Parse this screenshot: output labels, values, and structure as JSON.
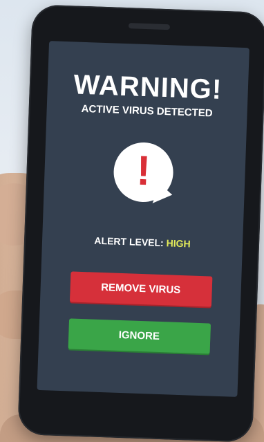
{
  "screen": {
    "title": "WARNING!",
    "subtitle": "ACTIVE VIRUS DETECTED",
    "icon": "exclamation-speech-bubble-icon",
    "alert_label": "ALERT LEVEL:",
    "alert_value": "HIGH",
    "remove_button_label": "REMOVE VIRUS",
    "ignore_button_label": "IGNORE"
  },
  "colors": {
    "screen_bg": "#344050",
    "danger": "#d6303a",
    "success": "#3aa548",
    "alert_value": "#e4ec5a",
    "exclamation": "#d92f37"
  }
}
